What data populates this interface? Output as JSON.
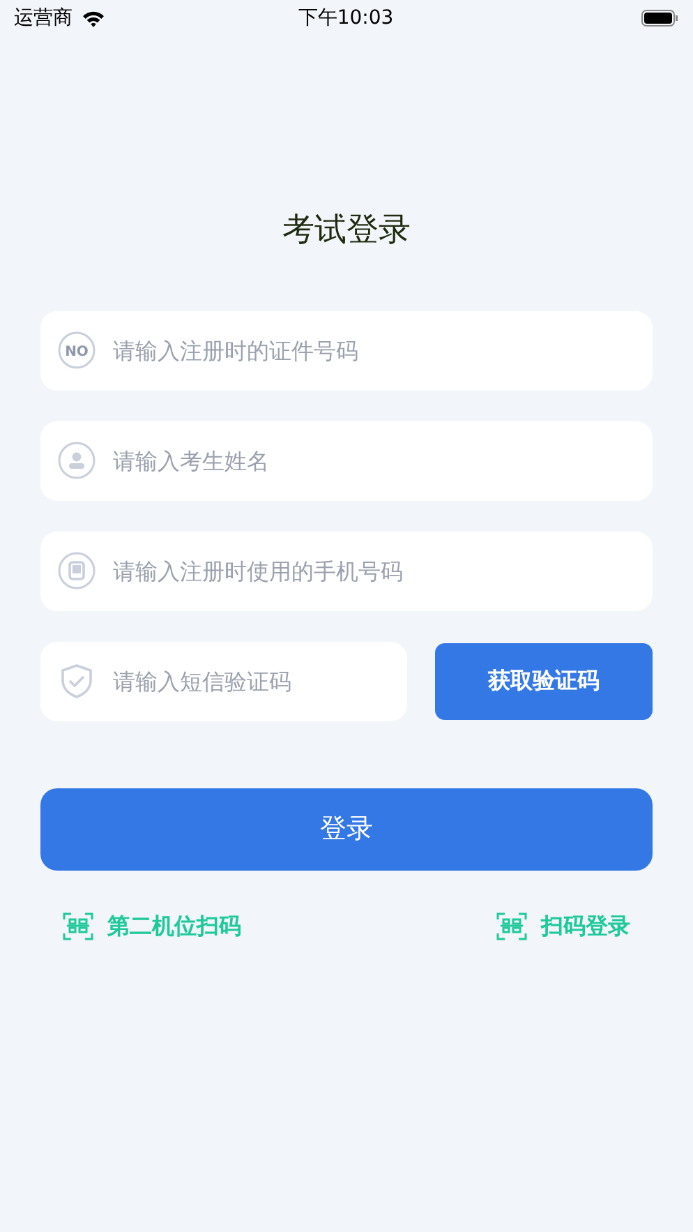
{
  "status_bar": {
    "carrier": "运营商",
    "time": "下午10:03"
  },
  "title": "考试登录",
  "fields": [
    {
      "kind": "id",
      "badge": "NO",
      "placeholder": "请输入注册时的证件号码"
    },
    {
      "kind": "person",
      "placeholder": "请输入考生姓名"
    },
    {
      "kind": "phone",
      "placeholder": "请输入注册时使用的手机号码"
    },
    {
      "kind": "shield",
      "placeholder": "请输入短信验证码"
    }
  ],
  "code_button": "获取验证码",
  "login_button": "登录",
  "links": [
    {
      "label": "第二机位扫码"
    },
    {
      "label": "扫码登录"
    }
  ]
}
